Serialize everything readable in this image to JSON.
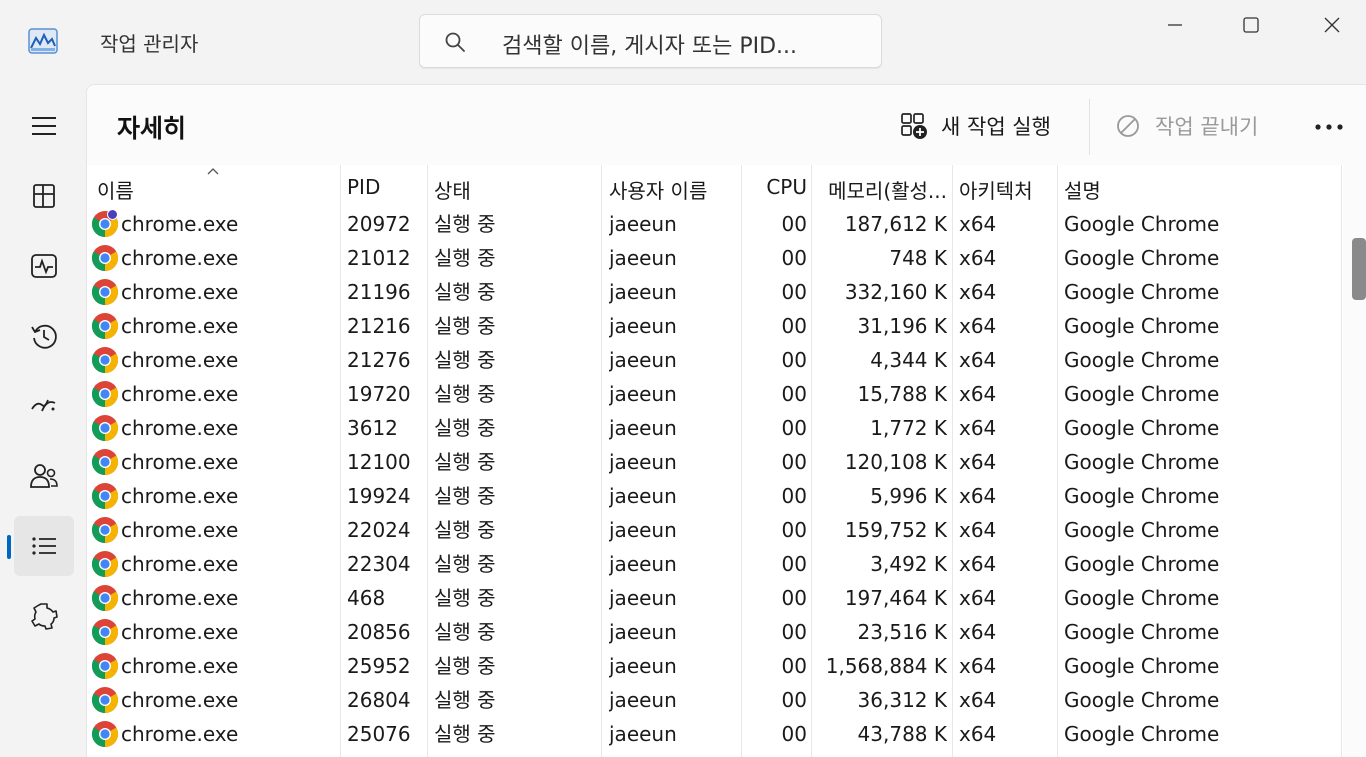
{
  "app": {
    "title": "작업 관리자",
    "search_placeholder": "검색할 이름, 게시자 또는 PID..."
  },
  "rail": {
    "items": [
      {
        "icon": "hamburger-menu-icon",
        "label": "메뉴"
      },
      {
        "icon": "processes-icon",
        "label": "프로세스"
      },
      {
        "icon": "performance-icon",
        "label": "성능"
      },
      {
        "icon": "app-history-icon",
        "label": "앱 기록"
      },
      {
        "icon": "startup-apps-icon",
        "label": "시작 앱"
      },
      {
        "icon": "users-icon",
        "label": "사용자"
      },
      {
        "icon": "details-icon",
        "label": "자세히",
        "active": true
      },
      {
        "icon": "services-icon",
        "label": "서비스"
      }
    ],
    "accent": "#0067c0"
  },
  "page": {
    "title": "자세히",
    "run_new_task": "새 작업 실행",
    "end_task": "작업 끝내기"
  },
  "table": {
    "columns": [
      "이름",
      "PID",
      "상태",
      "사용자 이름",
      "CPU",
      "메모리(활성...",
      "아키텍처",
      "설명"
    ],
    "rows": [
      {
        "name": "chrome.exe",
        "pid": "20972",
        "status": "실행 중",
        "user": "jaeeun",
        "cpu": "00",
        "memory": "187,612 K",
        "arch": "x64",
        "desc": "Google Chrome",
        "badge": true
      },
      {
        "name": "chrome.exe",
        "pid": "21012",
        "status": "실행 중",
        "user": "jaeeun",
        "cpu": "00",
        "memory": "748 K",
        "arch": "x64",
        "desc": "Google Chrome"
      },
      {
        "name": "chrome.exe",
        "pid": "21196",
        "status": "실행 중",
        "user": "jaeeun",
        "cpu": "00",
        "memory": "332,160 K",
        "arch": "x64",
        "desc": "Google Chrome"
      },
      {
        "name": "chrome.exe",
        "pid": "21216",
        "status": "실행 중",
        "user": "jaeeun",
        "cpu": "00",
        "memory": "31,196 K",
        "arch": "x64",
        "desc": "Google Chrome"
      },
      {
        "name": "chrome.exe",
        "pid": "21276",
        "status": "실행 중",
        "user": "jaeeun",
        "cpu": "00",
        "memory": "4,344 K",
        "arch": "x64",
        "desc": "Google Chrome"
      },
      {
        "name": "chrome.exe",
        "pid": "19720",
        "status": "실행 중",
        "user": "jaeeun",
        "cpu": "00",
        "memory": "15,788 K",
        "arch": "x64",
        "desc": "Google Chrome"
      },
      {
        "name": "chrome.exe",
        "pid": "3612",
        "status": "실행 중",
        "user": "jaeeun",
        "cpu": "00",
        "memory": "1,772 K",
        "arch": "x64",
        "desc": "Google Chrome"
      },
      {
        "name": "chrome.exe",
        "pid": "12100",
        "status": "실행 중",
        "user": "jaeeun",
        "cpu": "00",
        "memory": "120,108 K",
        "arch": "x64",
        "desc": "Google Chrome"
      },
      {
        "name": "chrome.exe",
        "pid": "19924",
        "status": "실행 중",
        "user": "jaeeun",
        "cpu": "00",
        "memory": "5,996 K",
        "arch": "x64",
        "desc": "Google Chrome"
      },
      {
        "name": "chrome.exe",
        "pid": "22024",
        "status": "실행 중",
        "user": "jaeeun",
        "cpu": "00",
        "memory": "159,752 K",
        "arch": "x64",
        "desc": "Google Chrome"
      },
      {
        "name": "chrome.exe",
        "pid": "22304",
        "status": "실행 중",
        "user": "jaeeun",
        "cpu": "00",
        "memory": "3,492 K",
        "arch": "x64",
        "desc": "Google Chrome"
      },
      {
        "name": "chrome.exe",
        "pid": "468",
        "status": "실행 중",
        "user": "jaeeun",
        "cpu": "00",
        "memory": "197,464 K",
        "arch": "x64",
        "desc": "Google Chrome"
      },
      {
        "name": "chrome.exe",
        "pid": "20856",
        "status": "실행 중",
        "user": "jaeeun",
        "cpu": "00",
        "memory": "23,516 K",
        "arch": "x64",
        "desc": "Google Chrome"
      },
      {
        "name": "chrome.exe",
        "pid": "25952",
        "status": "실행 중",
        "user": "jaeeun",
        "cpu": "00",
        "memory": "1,568,884 K",
        "arch": "x64",
        "desc": "Google Chrome"
      },
      {
        "name": "chrome.exe",
        "pid": "26804",
        "status": "실행 중",
        "user": "jaeeun",
        "cpu": "00",
        "memory": "36,312 K",
        "arch": "x64",
        "desc": "Google Chrome"
      },
      {
        "name": "chrome.exe",
        "pid": "25076",
        "status": "실행 중",
        "user": "jaeeun",
        "cpu": "00",
        "memory": "43,788 K",
        "arch": "x64",
        "desc": "Google Chrome"
      }
    ]
  }
}
